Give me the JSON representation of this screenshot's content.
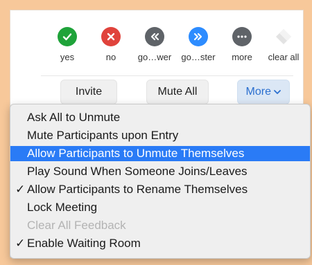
{
  "reactions": [
    {
      "label": "yes",
      "icon": "check-icon",
      "color": "#1fa33a"
    },
    {
      "label": "no",
      "icon": "x-icon",
      "color": "#e0433c"
    },
    {
      "label": "go…wer",
      "icon": "rewind-icon",
      "color": "#5f6368"
    },
    {
      "label": "go…ster",
      "icon": "fast-forward-icon",
      "color": "#2d8cff"
    },
    {
      "label": "more",
      "icon": "ellipsis-icon",
      "color": "#5f6368"
    },
    {
      "label": "clear all",
      "icon": "eraser-icon",
      "color": "#d8d8d8"
    }
  ],
  "buttons": {
    "invite": "Invite",
    "mute_all": "Mute All",
    "more": "More"
  },
  "menu": [
    {
      "label": "Ask All to Unmute",
      "checked": false,
      "highlighted": false,
      "disabled": false
    },
    {
      "label": "Mute Participants upon Entry",
      "checked": false,
      "highlighted": false,
      "disabled": false
    },
    {
      "label": "Allow Participants to Unmute Themselves",
      "checked": false,
      "highlighted": true,
      "disabled": false
    },
    {
      "label": "Play Sound When Someone Joins/Leaves",
      "checked": false,
      "highlighted": false,
      "disabled": false
    },
    {
      "label": "Allow Participants to Rename Themselves",
      "checked": true,
      "highlighted": false,
      "disabled": false
    },
    {
      "label": "Lock Meeting",
      "checked": false,
      "highlighted": false,
      "disabled": false
    },
    {
      "label": "Clear All Feedback",
      "checked": false,
      "highlighted": false,
      "disabled": true
    },
    {
      "label": "Enable Waiting Room",
      "checked": true,
      "highlighted": false,
      "disabled": false
    }
  ],
  "check_glyph": "✓",
  "chevron_glyph": "⌄"
}
